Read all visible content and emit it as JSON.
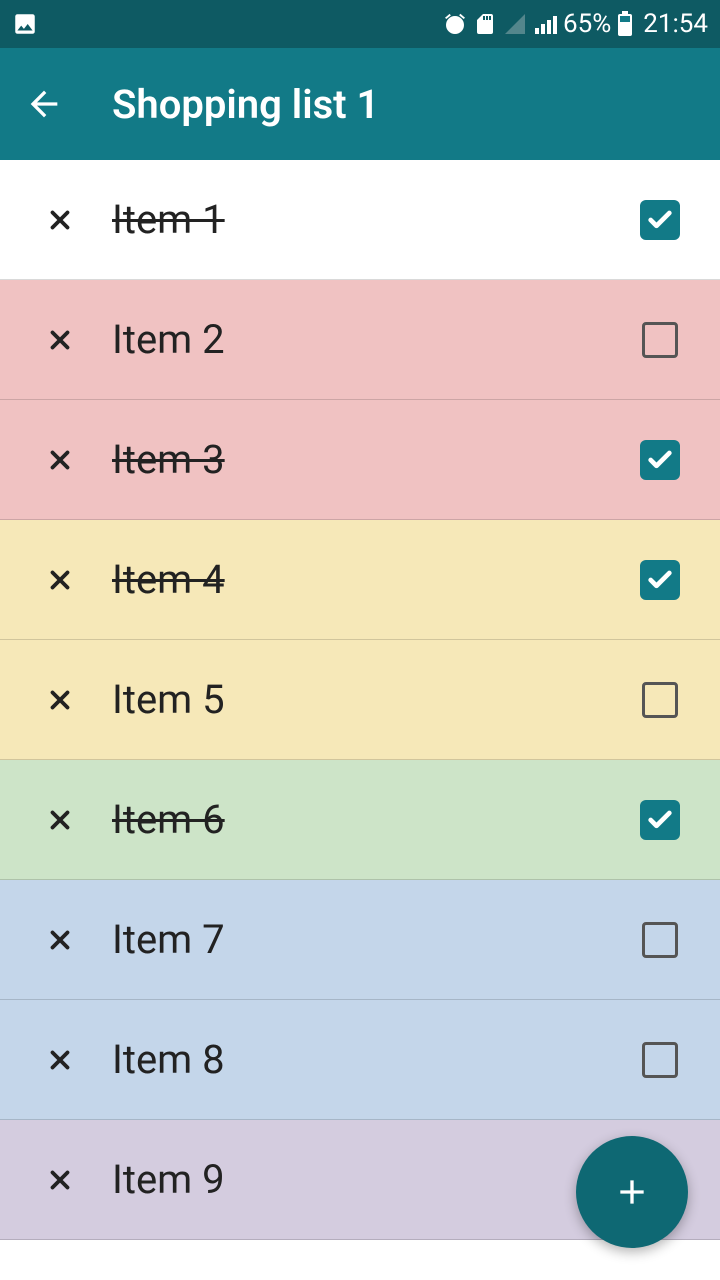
{
  "status": {
    "battery_pct": "65%",
    "time": "21:54"
  },
  "header": {
    "title": "Shopping list 1"
  },
  "colors": {
    "accent": "#127a87"
  },
  "items": [
    {
      "label": "Item 1",
      "checked": true,
      "color": "white"
    },
    {
      "label": "Item 2",
      "checked": false,
      "color": "red"
    },
    {
      "label": "Item 3",
      "checked": true,
      "color": "red"
    },
    {
      "label": "Item 4",
      "checked": true,
      "color": "yellow"
    },
    {
      "label": "Item 5",
      "checked": false,
      "color": "yellow"
    },
    {
      "label": "Item 6",
      "checked": true,
      "color": "green"
    },
    {
      "label": "Item 7",
      "checked": false,
      "color": "blue"
    },
    {
      "label": "Item 8",
      "checked": false,
      "color": "blue"
    },
    {
      "label": "Item 9",
      "checked": false,
      "color": "purple"
    }
  ]
}
